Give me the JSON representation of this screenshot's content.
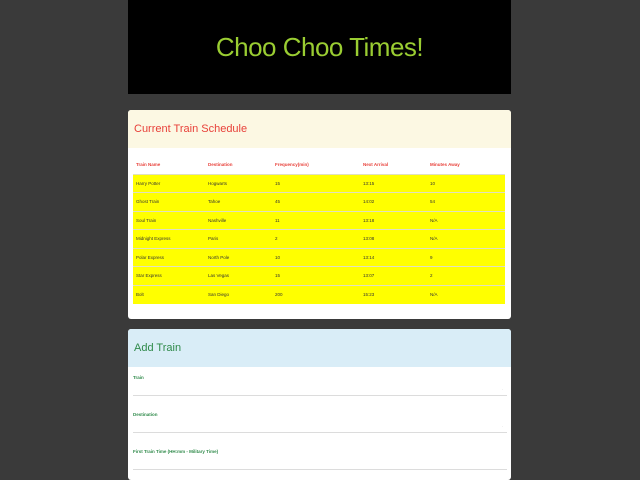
{
  "header": {
    "title": "Choo Choo Times!"
  },
  "schedule": {
    "heading": "Current Train Schedule",
    "columns": [
      "Train Name",
      "Destination",
      "Frequency(min)",
      "Next Arrival",
      "Minutes Away"
    ],
    "rows": [
      [
        "Harry Potter",
        "Hogwarts",
        "15",
        "13:15",
        "10"
      ],
      [
        "Ghost Train",
        "Tahoe",
        "45",
        "14:02",
        "54"
      ],
      [
        "Soul Train",
        "Nashville",
        "11",
        "13:18",
        "N/A"
      ],
      [
        "Midnight Express",
        "Paris",
        "2",
        "13:08",
        "N/A"
      ],
      [
        "Polar Express",
        "North Pole",
        "10",
        "13:14",
        "9"
      ],
      [
        "Star Express",
        "Las Vegas",
        "15",
        "13:07",
        "2"
      ],
      [
        "Bolt",
        "San Diego",
        "200",
        "15:23",
        "N/A"
      ]
    ]
  },
  "add_train": {
    "heading": "Add Train",
    "fields": [
      {
        "label": "Train"
      },
      {
        "label": "Destination"
      },
      {
        "label": "First Train Time (HH:mm - Military Time)"
      }
    ]
  },
  "colors": {
    "page_bg": "#3a3a3a",
    "jumbotron_bg": "#000000",
    "title_color": "#9acd32",
    "row_highlight": "#ffff00",
    "schedule_heading": "#e8413a",
    "add_heading": "#2f8a4a"
  }
}
